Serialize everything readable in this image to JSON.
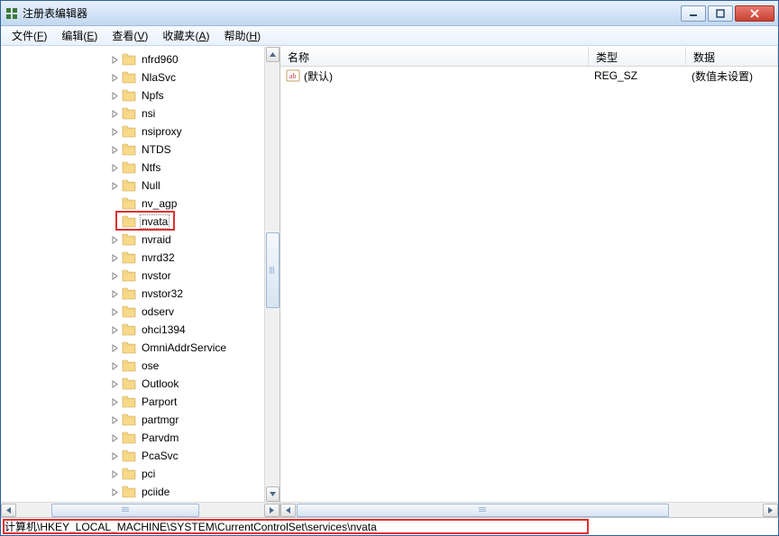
{
  "title": "注册表编辑器",
  "menu": {
    "file": {
      "label": "文件",
      "accel": "F"
    },
    "edit": {
      "label": "编辑",
      "accel": "E"
    },
    "view": {
      "label": "查看",
      "accel": "V"
    },
    "fav": {
      "label": "收藏夹",
      "accel": "A"
    },
    "help": {
      "label": "帮助",
      "accel": "H"
    }
  },
  "tree": [
    {
      "label": "nfrd960",
      "expandable": true
    },
    {
      "label": "NlaSvc",
      "expandable": true
    },
    {
      "label": "Npfs",
      "expandable": true
    },
    {
      "label": "nsi",
      "expandable": true
    },
    {
      "label": "nsiproxy",
      "expandable": true
    },
    {
      "label": "NTDS",
      "expandable": true
    },
    {
      "label": "Ntfs",
      "expandable": true
    },
    {
      "label": "Null",
      "expandable": true
    },
    {
      "label": "nv_agp",
      "expandable": false
    },
    {
      "label": "nvata",
      "expandable": false,
      "selected": true,
      "highlighted": true
    },
    {
      "label": "nvraid",
      "expandable": true
    },
    {
      "label": "nvrd32",
      "expandable": true
    },
    {
      "label": "nvstor",
      "expandable": true
    },
    {
      "label": "nvstor32",
      "expandable": true
    },
    {
      "label": "odserv",
      "expandable": true
    },
    {
      "label": "ohci1394",
      "expandable": true
    },
    {
      "label": "OmniAddrService",
      "expandable": true
    },
    {
      "label": "ose",
      "expandable": true
    },
    {
      "label": "Outlook",
      "expandable": true
    },
    {
      "label": "Parport",
      "expandable": true
    },
    {
      "label": "partmgr",
      "expandable": true
    },
    {
      "label": "Parvdm",
      "expandable": true
    },
    {
      "label": "PcaSvc",
      "expandable": true
    },
    {
      "label": "pci",
      "expandable": true
    },
    {
      "label": "pciide",
      "expandable": true
    }
  ],
  "list": {
    "cols": {
      "name": "名称",
      "type": "类型",
      "data": "数据"
    },
    "rows": [
      {
        "name": "(默认)",
        "type": "REG_SZ",
        "data": "(数值未设置)"
      }
    ]
  },
  "status": "计算机\\HKEY_LOCAL_MACHINE\\SYSTEM\\CurrentControlSet\\services\\nvata"
}
